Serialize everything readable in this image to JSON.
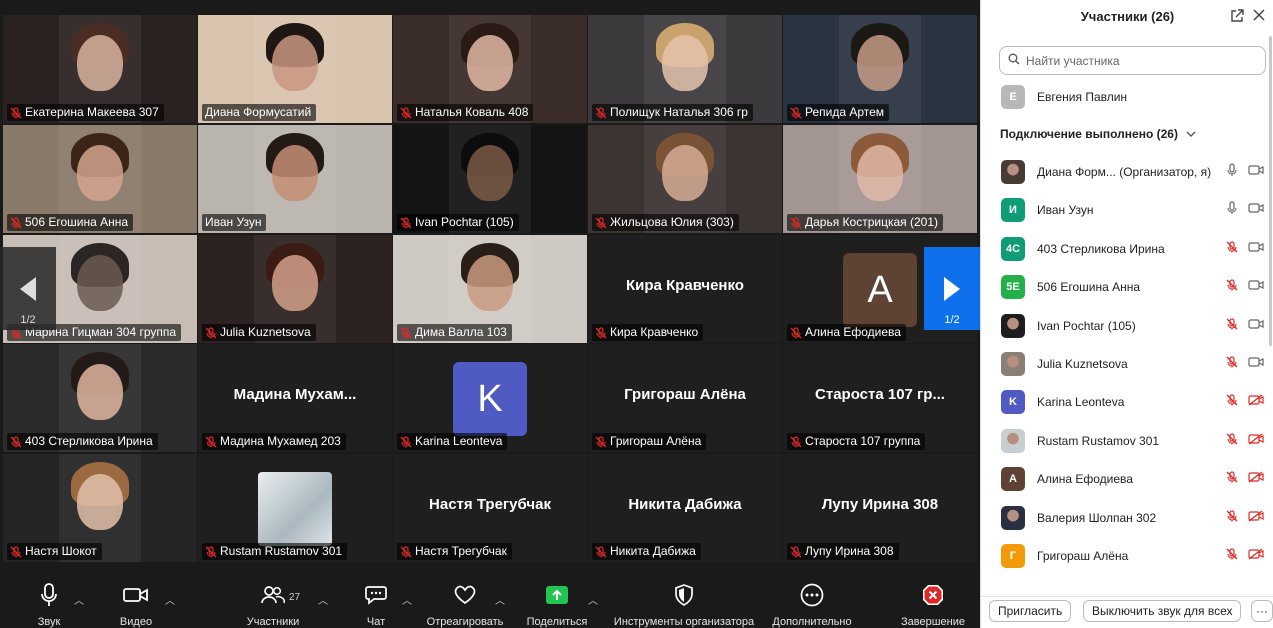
{
  "tiles": [
    {
      "name": "Екатерина Макеева 307",
      "muted": true,
      "bg": "#2a2220",
      "skin": "#d9b3a0",
      "hair": "#4a2c22"
    },
    {
      "name": "Диана Формусатий",
      "muted": false,
      "bg": "#d8c3ad",
      "skin": "#c99780",
      "hair": "#1f1714"
    },
    {
      "name": "Наталья Коваль 408",
      "muted": true,
      "bg": "#3a2c28",
      "skin": "#e2b8a5",
      "hair": "#2a1a14"
    },
    {
      "name": "Полищук Наталья 306 гр",
      "muted": true,
      "bg": "#3d3a3e",
      "skin": "#e5c3ac",
      "hair": "#c9a26e"
    },
    {
      "name": "Репида Артем",
      "muted": true,
      "bg": "#2a3440",
      "skin": "#c69b85",
      "hair": "#1c1814"
    },
    {
      "name": "506 Егошина Анна",
      "muted": true,
      "bg": "#8a7a6a",
      "skin": "#d4a48e",
      "hair": "#3a2518"
    },
    {
      "name": "Иван Узун",
      "muted": false,
      "bg": "#b9b4ad",
      "skin": "#c48e74",
      "hair": "#231a16",
      "speaking": true
    },
    {
      "name": "Ivan Pochtar (105)",
      "muted": true,
      "bg": "#141414",
      "skin": "#7a5a48",
      "hair": "#0c0c0c"
    },
    {
      "name": "Жильцова Юлия (303)",
      "muted": true,
      "bg": "#3b3431",
      "skin": "#d6ab95",
      "hair": "#7a5234"
    },
    {
      "name": "Дарья Кострицкая (201)",
      "muted": true,
      "bg": "#a39592",
      "skin": "#e0b8a8",
      "hair": "#8a5a3a"
    },
    {
      "name": "Марина Гицман 304 группа",
      "muted": true,
      "bg": "#c7bdb5",
      "skin": "#6a5a50",
      "hair": "#2b2624"
    },
    {
      "name": "Julia Kuznetsova",
      "muted": true,
      "bg": "#2c2220",
      "skin": "#d4a08a",
      "hair": "#3a1c14"
    },
    {
      "name": "Дима Валла 103",
      "muted": true,
      "bg": "#cfc9c3",
      "skin": "#c99a80",
      "hair": "#2a1e18"
    },
    {
      "name": "Кира Кравченко",
      "muted": true,
      "title": "Кира Кравченко"
    },
    {
      "name": "Алина Ефодиева",
      "muted": true,
      "initial": "A",
      "avcolor": "#5e4335"
    },
    {
      "name": "403 Стерликова Ирина",
      "muted": true,
      "bg": "#2b2b2b",
      "skin": "#e0b5a0",
      "hair": "#231b18"
    },
    {
      "name": "Мадина Мухамед 203",
      "muted": true,
      "title": "Мадина  Мухам..."
    },
    {
      "name": "Karina Leonteva",
      "muted": true,
      "initial": "K",
      "avcolor": "#4f5ac2"
    },
    {
      "name": "Григораш Алёна",
      "muted": true,
      "title": "Григораш Алёна"
    },
    {
      "name": "Староста 107 группа",
      "muted": true,
      "title": "Староста 107 гр..."
    },
    {
      "name": "Настя Шокот",
      "muted": true,
      "bg": "#242424",
      "skin": "#e3c0ac",
      "hair": "#9b6a40"
    },
    {
      "name": "Rustam Rustamov 301",
      "muted": true,
      "img": true
    },
    {
      "name": "Настя Трегубчак",
      "muted": true,
      "title": "Настя Трегубчак"
    },
    {
      "name": "Никита Дабижа",
      "muted": true,
      "title": "Никита Дабижа"
    },
    {
      "name": "Лупу Ирина 308",
      "muted": true,
      "title": "Лупу Ирина 308"
    }
  ],
  "nav": {
    "left_page": "1/2",
    "right_page": "1/2"
  },
  "toolbar": {
    "audio": "Звук",
    "video": "Видео",
    "participants": "Участники",
    "participants_count": "27",
    "chat": "Чат",
    "react": "Отреагировать",
    "share": "Поделиться",
    "host_tools": "Инструменты организатора",
    "more": "Дополнительно",
    "end": "Завершение"
  },
  "panel": {
    "title": "Участники (26)",
    "search_placeholder": "Найти участника",
    "waiting": {
      "initial": "Е",
      "name": "Евгения Павлин",
      "color": "#b8b8b8"
    },
    "section_title": "Подключение выполнено (26)",
    "participants": [
      {
        "initial": "",
        "name": "Диана Форм...  (Организатор, я)",
        "color": "#4a3a34",
        "mic": "on",
        "cam": "on",
        "photo": true
      },
      {
        "initial": "И",
        "name": "Иван Узун",
        "color": "#0f9d78",
        "mic": "on",
        "cam": "on"
      },
      {
        "initial": "4С",
        "name": "403 Стерликова Ирина",
        "color": "#0f9d78",
        "mic": "off",
        "cam": "on"
      },
      {
        "initial": "5Е",
        "name": "506 Егошина Анна",
        "color": "#23b04a",
        "mic": "off",
        "cam": "on"
      },
      {
        "initial": "",
        "name": "Ivan Pochtar (105)",
        "color": "#1e1e1e",
        "mic": "off",
        "cam": "on",
        "photo": true
      },
      {
        "initial": "",
        "name": "Julia Kuznetsova",
        "color": "#8a7f74",
        "mic": "off",
        "cam": "on",
        "photo": true
      },
      {
        "initial": "K",
        "name": "Karina Leonteva",
        "color": "#4f5ac2",
        "mic": "off",
        "cam": "off"
      },
      {
        "initial": "",
        "name": "Rustam Rustamov 301",
        "color": "#c7cfd3",
        "mic": "off",
        "cam": "off",
        "photo": true
      },
      {
        "initial": "A",
        "name": "Алина Ефодиева",
        "color": "#5e4335",
        "mic": "off",
        "cam": "off"
      },
      {
        "initial": "",
        "name": "Валерия Шолпан 302",
        "color": "#2a3040",
        "mic": "off",
        "cam": "off",
        "photo": true
      },
      {
        "initial": "Г",
        "name": "Григораш Алёна",
        "color": "#f29a0a",
        "mic": "off",
        "cam": "off"
      }
    ],
    "invite": "Пригласить",
    "mute_all": "Выключить звук для всех",
    "more": "···"
  },
  "colors": {
    "accent": "#0e71eb",
    "speaking": "#3bd36b",
    "muted_red": "#e02828"
  }
}
